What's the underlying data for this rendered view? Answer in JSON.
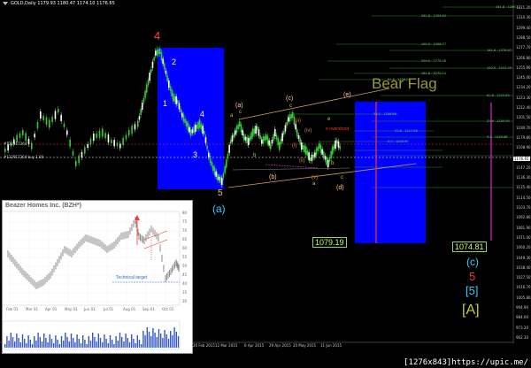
{
  "window": {
    "title": "GOLD,Daily  1179.93 1180.47 1174.10 1176.65"
  },
  "colors": {
    "bg": "#000000",
    "blue_box": "#0000ff",
    "bullish": "#33cc33",
    "bearish": "#ffffff",
    "accent_red": "#ff3333",
    "bear_flag": "#999933",
    "magenta": "#cc33cc"
  },
  "chart": {
    "title": "Bear Flag",
    "wave_labels": {
      "w4": "4",
      "w2": "2",
      "w1": "1",
      "w4b": "4",
      "w3": "3",
      "w5": "5",
      "wa_circle": "(a)",
      "a_small": "(a)",
      "c_small": "(c)",
      "e_small": "(e)",
      "b_small": "(b)",
      "d_small": "(d)",
      "iii": "(iii)",
      "iv": "(iv)",
      "i": "(i)",
      "v": "(v)",
      "ii": "(ii)",
      "a1": "a",
      "b1": "b",
      "c1": "c",
      "e1": "e",
      "a2": "a",
      "c2": "c",
      "d2": "d",
      "b2": "b",
      "c3": "c",
      "overshoot": "e overshoot",
      "stack_c": "(c)",
      "stack_5": "5",
      "stack_box5": "[5]",
      "stack_A": "[A]"
    },
    "price_boxes": {
      "left": "1079.19",
      "right": "1074.81"
    },
    "hlines": {
      "h1": "#132917264",
      "h2": "#132917264 buy 1.00"
    },
    "fib_labels": [
      "161.8 - 1286.52",
      "261.8 - 1339.63",
      "100.0 - 1298.37",
      "161.8 - 1276.67",
      "200.0 - 1278.08",
      "100.0 - 1231.45",
      "161.8 - 1272.24",
      "61.8 - 1236.02",
      "61.8 - 1215.63",
      "38.2 - 1206.88",
      "23.6 - 1200.90",
      "23.6 - 1217.08",
      "0.0 - 1190.86",
      "0.0 - 1200.90"
    ],
    "y_axis": [
      "1321.20",
      "1310.30",
      "1299.40",
      "1288.50",
      "1277.70",
      "1266.80",
      "1255.90",
      "1245.00",
      "1234.20",
      "1223.30",
      "1212.40",
      "1201.50",
      "1190.70",
      "1179.80",
      "1168.90",
      "1158.00",
      "1147.20",
      "1136.30",
      "1125.40",
      "1114.50",
      "1103.70",
      "1092.80",
      "1081.90",
      "1071.00",
      "1060.20",
      "1049.30",
      "1038.40",
      "1027.50",
      "1016.70",
      "1005.80",
      "994.90",
      "984.00",
      "973.20",
      "962.30"
    ],
    "y_axis_current": "1176.65",
    "x_axis": [
      "26 Feb 2015",
      "12 Mar 2015",
      "6 Apr 2015",
      "29 Apr 2015",
      "20 May 2015",
      "11 Jun 2015"
    ]
  },
  "inset": {
    "title": "Beazer Homes Inc. (BZH*)",
    "note": "Technical target",
    "y_axis": [
      "80",
      "75",
      "70",
      "65",
      "60",
      "55",
      "50",
      "45",
      "40",
      "35",
      "30"
    ],
    "x_axis": [
      "Feb 01",
      "Mar 01",
      "Apr 01",
      "May 01",
      "Jun 01",
      "Jul 01",
      "Aug 01",
      "Sep 01",
      "Oct 01"
    ]
  },
  "watermark": "[1276x843]https://upic.me/"
}
